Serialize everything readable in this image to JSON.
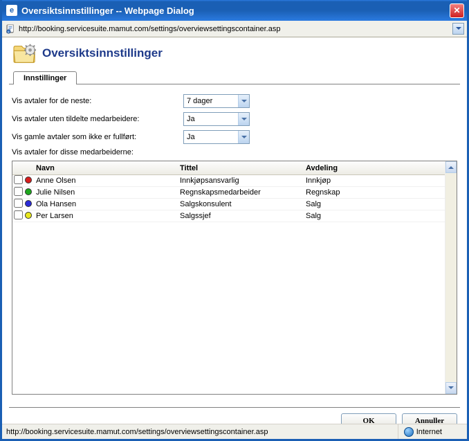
{
  "window": {
    "title": "Oversiktsinnstillinger -- Webpage Dialog",
    "url": "http://booking.servicesuite.mamut.com/settings/overviewsettingscontainer.asp"
  },
  "page": {
    "heading": "Oversiktsinnstillinger"
  },
  "tab": {
    "label": "Innstillinger"
  },
  "form": {
    "days_label": "Vis avtaler for de neste:",
    "days_value": "7 dager",
    "unassigned_label": "Vis avtaler uten tildelte medarbeidere:",
    "unassigned_value": "Ja",
    "old_label": "Vis gamle avtaler som ikke er fullført:",
    "old_value": "Ja",
    "employees_label": "Vis avtaler for disse medarbeiderne:"
  },
  "grid": {
    "headers": {
      "name": "Navn",
      "title": "Tittel",
      "dept": "Avdeling"
    },
    "rows": [
      {
        "color": "#d81e1e",
        "name": "Anne Olsen",
        "title": "Innkjøpsansvarlig",
        "dept": "Innkjøp"
      },
      {
        "color": "#1ea81e",
        "name": "Julie Nilsen",
        "title": "Regnskapsmedarbeider",
        "dept": "Regnskap"
      },
      {
        "color": "#2b2bd8",
        "name": "Ola Hansen",
        "title": "Salgskonsulent",
        "dept": "Salg"
      },
      {
        "color": "#e8e81e",
        "name": "Per Larsen",
        "title": "Salgssjef",
        "dept": "Salg"
      }
    ]
  },
  "buttons": {
    "ok": "OK",
    "cancel": "Annuller"
  },
  "status": {
    "url": "http://booking.servicesuite.mamut.com/settings/overviewsettingscontainer.asp",
    "zone": "Internet"
  }
}
